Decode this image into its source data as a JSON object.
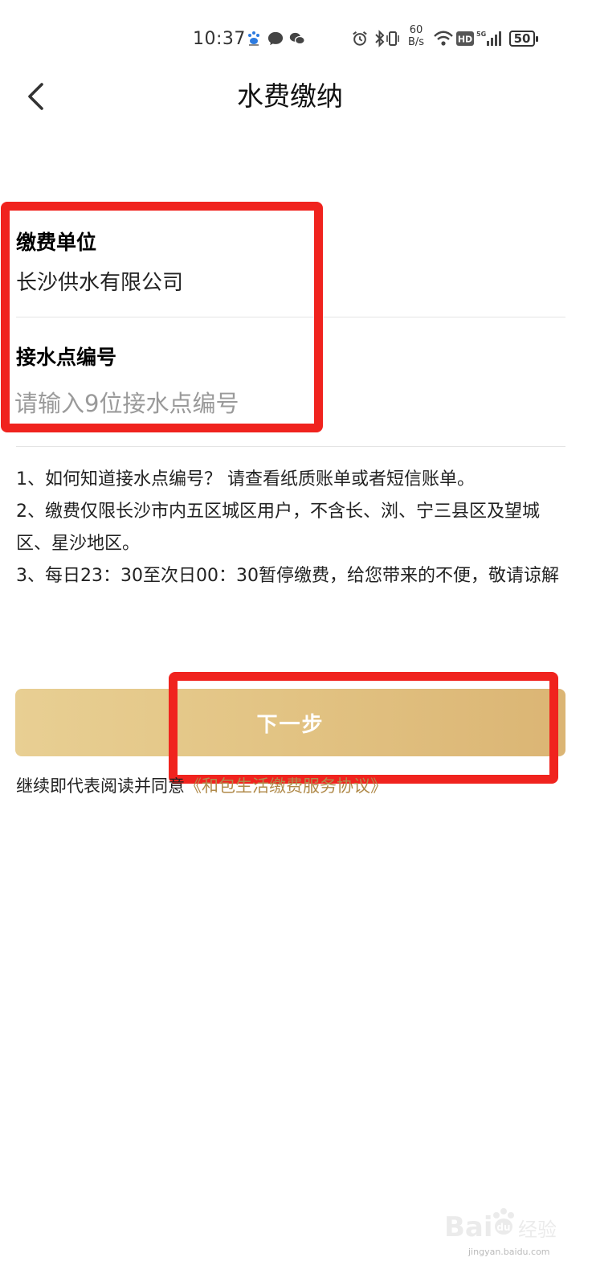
{
  "status_bar": {
    "time": "10:37",
    "net_speed_value": "60",
    "net_speed_unit": "B/s",
    "battery_level": "50",
    "icons": [
      "paw-icon",
      "message-icon",
      "wechat-icon",
      "alarm-icon",
      "bluetooth-icon",
      "vibrate-icon",
      "wifi-icon",
      "hd-icon",
      "signal-5g-icon",
      "battery-icon"
    ]
  },
  "header": {
    "title": "水费缴纳",
    "back_icon": "chevron-left-icon"
  },
  "form": {
    "unit_label": "缴费单位",
    "unit_value": "长沙供水有限公司",
    "account_label": "接水点编号",
    "account_placeholder": "请输入9位接水点编号",
    "account_value": ""
  },
  "notes": [
    "1、如何知道接水点编号？ 请查看纸质账单或者短信账单。",
    "2、缴费仅限长沙市内五区城区用户，不含长、浏、宁三县区及望城区、星沙地区。",
    "3、每日23：30至次日00：30暂停缴费，给您带来的不便，敬请谅解"
  ],
  "next_button": {
    "label": "下一步"
  },
  "agreement": {
    "prefix": "继续即代表阅读并同意",
    "link": "《和包生活缴费服务协议》"
  },
  "watermark": {
    "brand": "Bai",
    "brand_suffix": "du",
    "chinese": "经验",
    "url": "jingyan.baidu.com"
  },
  "colors": {
    "highlight": "#f0231e",
    "button_gold": "#e2c383",
    "link_gold": "#b08a4a"
  }
}
